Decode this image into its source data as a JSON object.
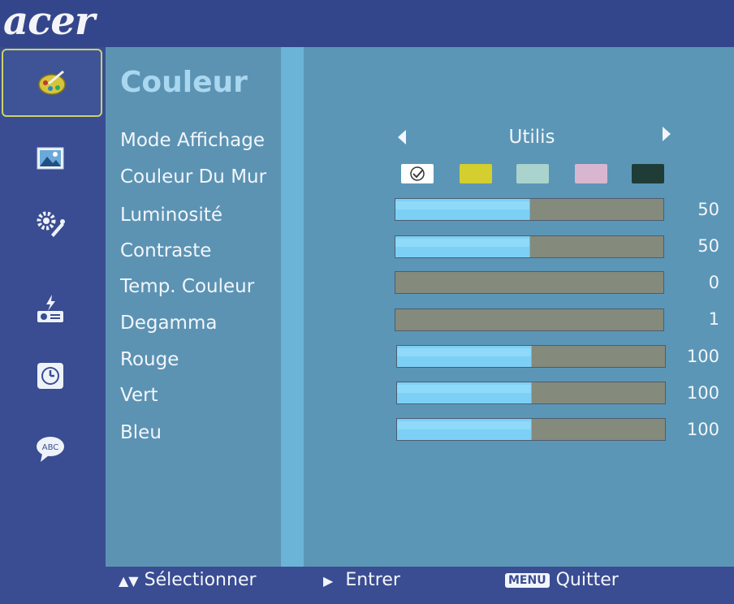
{
  "brand": {
    "logo": "acer"
  },
  "sidebar": {
    "items": [
      {
        "name": "color",
        "icon": "palette-icon",
        "active": true
      },
      {
        "name": "image",
        "icon": "picture-icon",
        "active": false
      },
      {
        "name": "settings",
        "icon": "gear-wrench-icon",
        "active": false
      },
      {
        "name": "management",
        "icon": "projector-icon",
        "active": false
      },
      {
        "name": "timer",
        "icon": "clock-icon",
        "active": false
      },
      {
        "name": "language",
        "icon": "abc-speech-bubble-icon",
        "active": false
      }
    ]
  },
  "main": {
    "title": "Couleur",
    "rows": {
      "mode_affichage": {
        "label": "Mode Affichage",
        "value": "Utilis"
      },
      "couleur_du_mur": {
        "label": "Couleur Du Mur",
        "swatches": [
          "#ffffff",
          "#d4cf2e",
          "#a9d3cc",
          "#d9b6cf",
          "#1f3c37"
        ],
        "selected_index": 0
      },
      "luminosite": {
        "label": "Luminosité",
        "value": "50",
        "fill": 0.5
      },
      "contraste": {
        "label": "Contraste",
        "value": "50",
        "fill": 0.5
      },
      "temp_couleur": {
        "label": "Temp. Couleur",
        "value": "0",
        "fill": 0
      },
      "degamma": {
        "label": "Degamma",
        "value": "1",
        "fill": 0
      },
      "rouge": {
        "label": "Rouge",
        "value": "100",
        "fill": 0.5
      },
      "vert": {
        "label": "Vert",
        "value": "100",
        "fill": 0.5
      },
      "bleu": {
        "label": "Bleu",
        "value": "100",
        "fill": 0.5
      }
    }
  },
  "footer": {
    "select_label": "Sélectionner",
    "enter_label": "Entrer",
    "menu_key": "MENU",
    "quit_label": "Quitter"
  },
  "colors": {
    "accent": "#a9d7f0",
    "bar_fill": "#7dd0f5",
    "bar_empty": "#848a7c"
  }
}
